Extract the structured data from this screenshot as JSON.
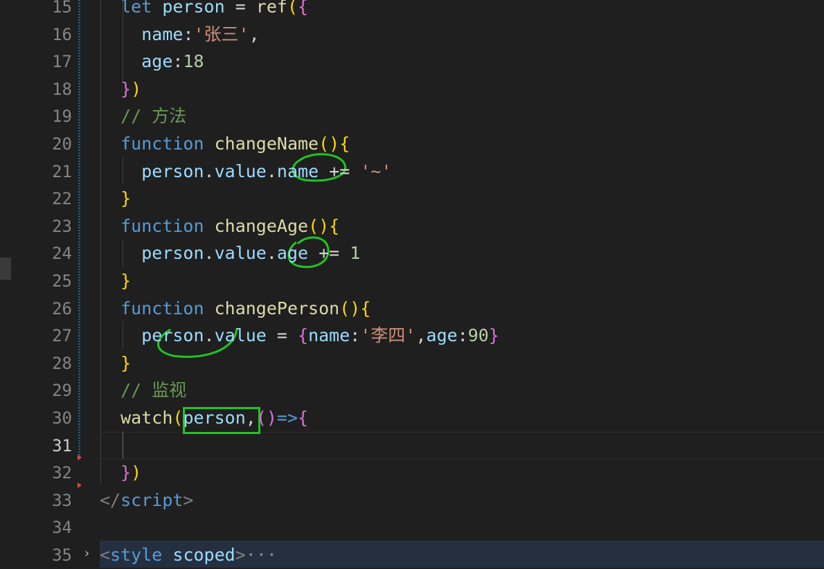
{
  "editor": {
    "lines": [
      {
        "num": "15",
        "tokens": [
          {
            "t": "  "
          },
          {
            "t": "let",
            "c": "kw"
          },
          {
            "t": " "
          },
          {
            "t": "person",
            "c": "var"
          },
          {
            "t": " = "
          },
          {
            "t": "ref",
            "c": "fn"
          },
          {
            "t": "(",
            "c": "b1"
          },
          {
            "t": "{",
            "c": "b2"
          }
        ]
      },
      {
        "num": "16",
        "tokens": [
          {
            "t": "    "
          },
          {
            "t": "name",
            "c": "var"
          },
          {
            "t": ":"
          },
          {
            "t": "'张三'",
            "c": "str"
          },
          {
            "t": ","
          }
        ]
      },
      {
        "num": "17",
        "tokens": [
          {
            "t": "    "
          },
          {
            "t": "age",
            "c": "var"
          },
          {
            "t": ":"
          },
          {
            "t": "18",
            "c": "num"
          }
        ]
      },
      {
        "num": "18",
        "tokens": [
          {
            "t": "  "
          },
          {
            "t": "}",
            "c": "b2"
          },
          {
            "t": ")",
            "c": "b1"
          }
        ]
      },
      {
        "num": "19",
        "tokens": [
          {
            "t": "  "
          },
          {
            "t": "// 方法",
            "c": "cmt"
          }
        ]
      },
      {
        "num": "20",
        "tokens": [
          {
            "t": "  "
          },
          {
            "t": "function",
            "c": "kw"
          },
          {
            "t": " "
          },
          {
            "t": "changeName",
            "c": "fn"
          },
          {
            "t": "()",
            "c": "b1"
          },
          {
            "t": "{",
            "c": "b1"
          }
        ]
      },
      {
        "num": "21",
        "tokens": [
          {
            "t": "    "
          },
          {
            "t": "person",
            "c": "var"
          },
          {
            "t": "."
          },
          {
            "t": "value",
            "c": "var"
          },
          {
            "t": "."
          },
          {
            "t": "name",
            "c": "var"
          },
          {
            "t": " += "
          },
          {
            "t": "'~'",
            "c": "str"
          }
        ]
      },
      {
        "num": "22",
        "tokens": [
          {
            "t": "  "
          },
          {
            "t": "}",
            "c": "b1"
          }
        ]
      },
      {
        "num": "23",
        "tokens": [
          {
            "t": "  "
          },
          {
            "t": "function",
            "c": "kw"
          },
          {
            "t": " "
          },
          {
            "t": "changeAge",
            "c": "fn"
          },
          {
            "t": "()",
            "c": "b1"
          },
          {
            "t": "{",
            "c": "b1"
          }
        ]
      },
      {
        "num": "24",
        "tokens": [
          {
            "t": "    "
          },
          {
            "t": "person",
            "c": "var"
          },
          {
            "t": "."
          },
          {
            "t": "value",
            "c": "var"
          },
          {
            "t": "."
          },
          {
            "t": "age",
            "c": "var"
          },
          {
            "t": " += "
          },
          {
            "t": "1",
            "c": "num"
          }
        ]
      },
      {
        "num": "25",
        "tokens": [
          {
            "t": "  "
          },
          {
            "t": "}",
            "c": "b1"
          }
        ]
      },
      {
        "num": "26",
        "tokens": [
          {
            "t": "  "
          },
          {
            "t": "function",
            "c": "kw"
          },
          {
            "t": " "
          },
          {
            "t": "changePerson",
            "c": "fn"
          },
          {
            "t": "()",
            "c": "b1"
          },
          {
            "t": "{",
            "c": "b1"
          }
        ]
      },
      {
        "num": "27",
        "tokens": [
          {
            "t": "    "
          },
          {
            "t": "person",
            "c": "var"
          },
          {
            "t": "."
          },
          {
            "t": "value",
            "c": "var"
          },
          {
            "t": " = "
          },
          {
            "t": "{",
            "c": "b2"
          },
          {
            "t": "name",
            "c": "var"
          },
          {
            "t": ":"
          },
          {
            "t": "'李四'",
            "c": "str"
          },
          {
            "t": ","
          },
          {
            "t": "age",
            "c": "var"
          },
          {
            "t": ":"
          },
          {
            "t": "90",
            "c": "num"
          },
          {
            "t": "}",
            "c": "b2"
          }
        ]
      },
      {
        "num": "28",
        "tokens": [
          {
            "t": "  "
          },
          {
            "t": "}",
            "c": "b1"
          }
        ]
      },
      {
        "num": "29",
        "tokens": [
          {
            "t": "  "
          },
          {
            "t": "// 监视",
            "c": "cmt"
          }
        ]
      },
      {
        "num": "30",
        "tokens": [
          {
            "t": "  "
          },
          {
            "t": "watch",
            "c": "fn"
          },
          {
            "t": "(",
            "c": "b1"
          },
          {
            "t": "person",
            "c": "var"
          },
          {
            "t": ","
          },
          {
            "t": "()",
            "c": "b2"
          },
          {
            "t": "=>",
            "c": "kw"
          },
          {
            "t": "{",
            "c": "b2"
          }
        ]
      },
      {
        "num": "31",
        "tokens": []
      },
      {
        "num": "32",
        "tokens": [
          {
            "t": "  "
          },
          {
            "t": "}",
            "c": "b2"
          },
          {
            "t": ")",
            "c": "b1"
          }
        ]
      },
      {
        "num": "33",
        "tokens": [
          {
            "t": "</",
            "c": "tag"
          },
          {
            "t": "script",
            "c": "tagname"
          },
          {
            "t": ">",
            "c": "tag"
          }
        ]
      },
      {
        "num": "34",
        "tokens": []
      },
      {
        "num": "35",
        "tokens": [
          {
            "t": "<",
            "c": "tag"
          },
          {
            "t": "style",
            "c": "tagname"
          },
          {
            "t": " "
          },
          {
            "t": "scoped",
            "c": "attr"
          },
          {
            "t": ">",
            "c": "tag"
          },
          {
            "t": "···",
            "c": "ellipsis"
          }
        ]
      }
    ],
    "active_line": "31",
    "fold_icon": "chevron-right-icon"
  },
  "colors": {
    "background": "#1f1f1f",
    "keyword": "#569cd6",
    "variable": "#9cdcfe",
    "function": "#dcdcaa",
    "string": "#ce9178",
    "number": "#b5cea8",
    "comment": "#6a9955",
    "bracket_gold": "#ffd700",
    "bracket_purple": "#da70d6",
    "annotation": "#22c522"
  },
  "annotations": [
    {
      "kind": "circle",
      "target": "name (line 21)"
    },
    {
      "kind": "circle",
      "target": "age (line 24)"
    },
    {
      "kind": "underline",
      "target": "person.value (line 27)"
    },
    {
      "kind": "box",
      "target": "person (line 30)"
    }
  ]
}
